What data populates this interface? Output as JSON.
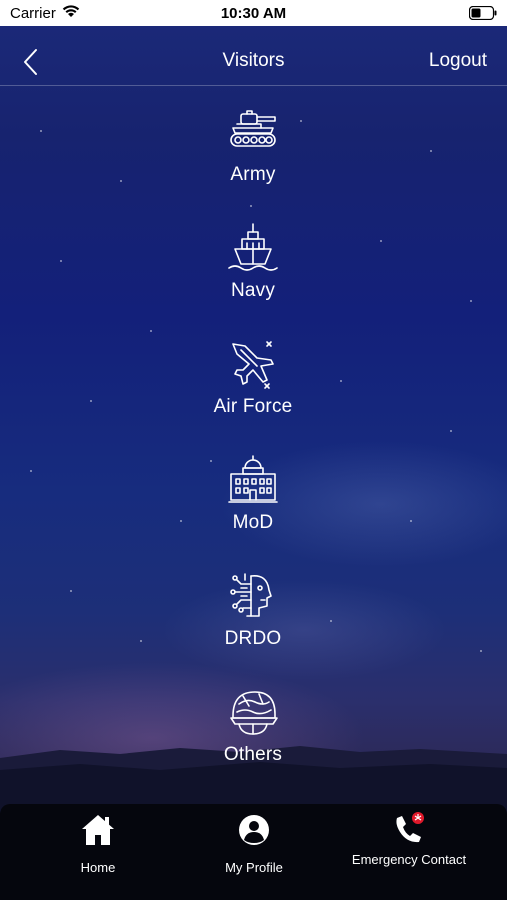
{
  "status_bar": {
    "carrier": "Carrier",
    "time": "10:30 AM"
  },
  "nav": {
    "title": "Visitors",
    "logout_label": "Logout"
  },
  "categories": [
    {
      "label": "Army",
      "icon": "tank-icon"
    },
    {
      "label": "Navy",
      "icon": "ship-icon"
    },
    {
      "label": "Air Force",
      "icon": "fighter-jet-icon"
    },
    {
      "label": "MoD",
      "icon": "government-building-icon"
    },
    {
      "label": "DRDO",
      "icon": "robot-head-icon"
    },
    {
      "label": "Others",
      "icon": "combat-helmet-icon"
    }
  ],
  "tabs": [
    {
      "label": "Home",
      "icon": "home-icon"
    },
    {
      "label": "My Profile",
      "icon": "profile-icon"
    },
    {
      "label": "Emergency Contact",
      "icon": "emergency-phone-icon"
    }
  ],
  "colors": {
    "background_top": "#1c2a7a",
    "tab_bar": "#05060d",
    "emergency_accent": "#e0192b",
    "text": "#ffffff"
  }
}
